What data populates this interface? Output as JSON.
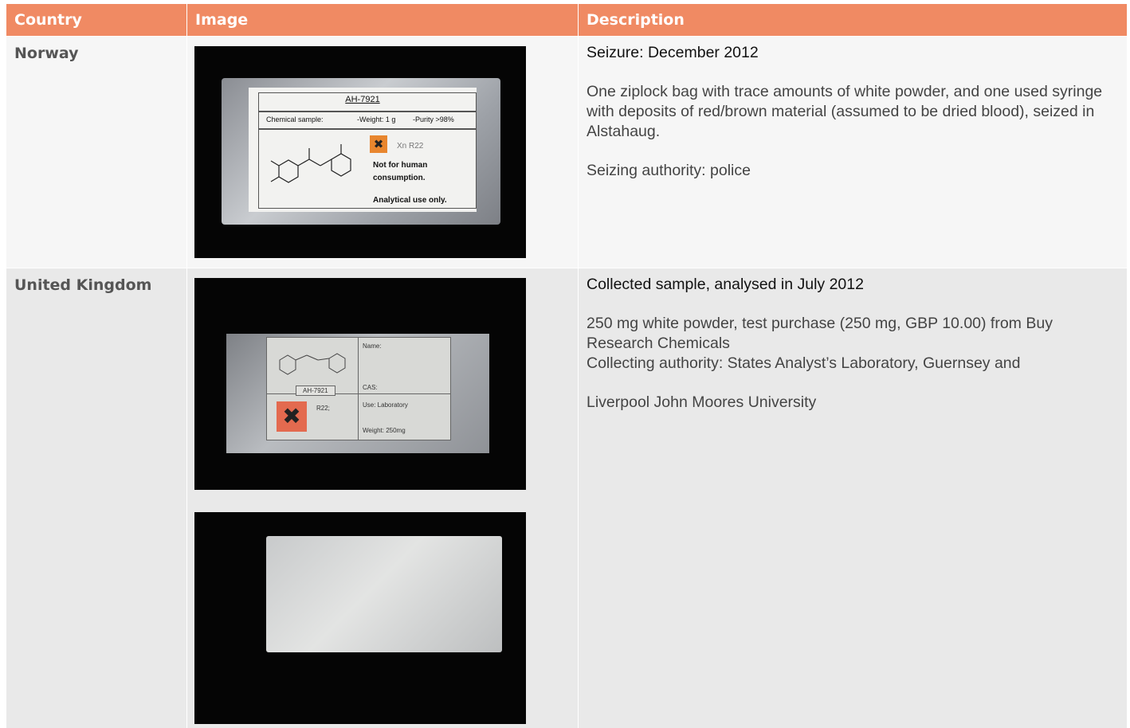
{
  "table": {
    "headers": {
      "country": "Country",
      "image": "Image",
      "description": "Description"
    },
    "rows": [
      {
        "country": "Norway",
        "heading": "Seizure: December 2012",
        "paragraphs": [
          "One ziplock bag with trace amounts of white powder, and one used syringe with deposits of red/brown material (assumed to be dried blood), seized in Alstahaug.",
          "Seizing authority: police"
        ],
        "photo_label": {
          "title": "AH-7921",
          "sample": "Chemical sample:",
          "weight": "-Weight: 1 g",
          "purity": "-Purity >98%",
          "hazard": "Xn R22",
          "warning1": "Not for human",
          "warning2": "consumption.",
          "use": "Analytical use only."
        }
      },
      {
        "country": "United Kingdom",
        "heading": "Collected sample, analysed in July 2012",
        "paragraphs": [
          "250 mg white powder, test purchase (250 mg, GBP 10.00) from Buy Research Chemicals\nCollecting authority: States Analyst’s Laboratory, Guernsey and",
          "Liverpool John Moores University"
        ],
        "photo_label": {
          "name": "Name:",
          "code": "AH-7921",
          "cas": "CAS:",
          "hazard": "R22;",
          "use": "Use: Laboratory",
          "weight": "Weight: 250mg"
        }
      }
    ]
  },
  "colors": {
    "header_bg": "#f08a63",
    "row1_bg": "#f6f6f6",
    "row2_bg": "#e9e9e9"
  }
}
